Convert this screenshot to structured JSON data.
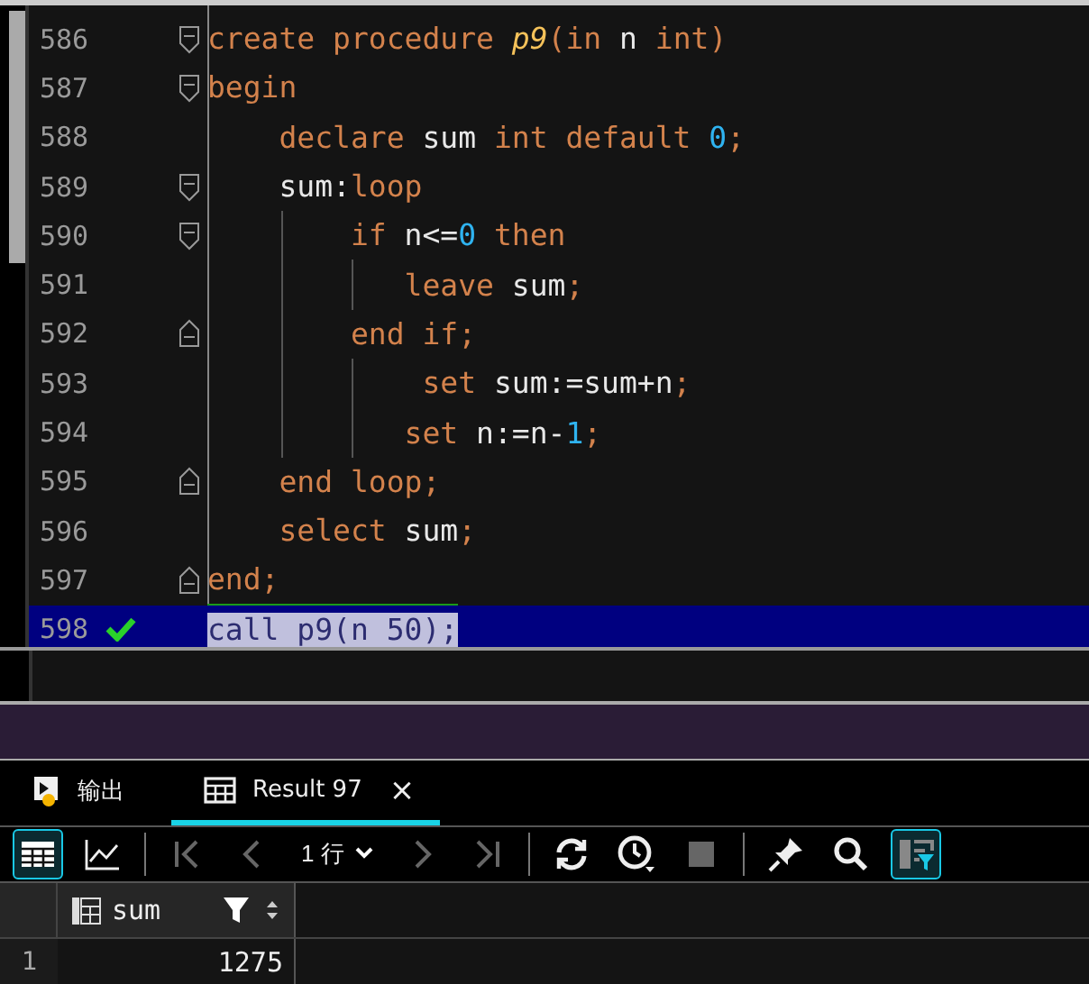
{
  "editor": {
    "lines": [
      {
        "number": "586",
        "kind": "fold_start",
        "current": false,
        "tokens": [
          {
            "kind": "kw",
            "text": "create procedure "
          },
          {
            "kind": "fn",
            "text": "p9"
          },
          {
            "kind": "kw",
            "text": "(in "
          },
          {
            "kind": "id",
            "text": "n"
          },
          {
            "kind": "kw",
            "text": " int)"
          }
        ]
      },
      {
        "number": "587",
        "kind": "fold_start",
        "current": false,
        "tokens": [
          {
            "kind": "kw",
            "text": "begin"
          }
        ]
      },
      {
        "number": "588",
        "kind": "plain",
        "current": false,
        "tokens": [
          {
            "kind": "kw",
            "text": "    declare "
          },
          {
            "kind": "id",
            "text": "sum"
          },
          {
            "kind": "kw",
            "text": " int default "
          },
          {
            "kind": "num",
            "text": "0"
          },
          {
            "kind": "kw",
            "text": ";"
          }
        ]
      },
      {
        "number": "589",
        "kind": "fold_start",
        "current": false,
        "tokens": [
          {
            "kind": "id",
            "text": "    sum:"
          },
          {
            "kind": "kw",
            "text": "loop"
          }
        ]
      },
      {
        "number": "590",
        "kind": "fold_start",
        "current": false,
        "tokens": [
          {
            "kind": "kw",
            "text": "        if "
          },
          {
            "kind": "id",
            "text": "n<="
          },
          {
            "kind": "num",
            "text": "0"
          },
          {
            "kind": "kw",
            "text": " then"
          }
        ]
      },
      {
        "number": "591",
        "kind": "plain",
        "current": false,
        "tokens": [
          {
            "kind": "kw",
            "text": "           leave "
          },
          {
            "kind": "id",
            "text": "sum"
          },
          {
            "kind": "kw",
            "text": ";"
          }
        ]
      },
      {
        "number": "592",
        "kind": "fold_end",
        "current": false,
        "tokens": [
          {
            "kind": "kw",
            "text": "        end if;"
          }
        ]
      },
      {
        "number": "593",
        "kind": "plain",
        "current": false,
        "tokens": [
          {
            "kind": "kw",
            "text": "            set "
          },
          {
            "kind": "id",
            "text": "sum:=sum+n"
          },
          {
            "kind": "kw",
            "text": ";"
          }
        ]
      },
      {
        "number": "594",
        "kind": "plain",
        "current": false,
        "tokens": [
          {
            "kind": "kw",
            "text": "           set "
          },
          {
            "kind": "id",
            "text": "n:=n-"
          },
          {
            "kind": "num",
            "text": "1"
          },
          {
            "kind": "kw",
            "text": ";"
          }
        ]
      },
      {
        "number": "595",
        "kind": "fold_end",
        "current": false,
        "tokens": [
          {
            "kind": "kw",
            "text": "    end loop;"
          }
        ]
      },
      {
        "number": "596",
        "kind": "plain",
        "current": false,
        "tokens": [
          {
            "kind": "kw",
            "text": "    select "
          },
          {
            "kind": "id",
            "text": "sum"
          },
          {
            "kind": "kw",
            "text": ";"
          }
        ]
      },
      {
        "number": "597",
        "kind": "fold_end",
        "current": false,
        "tokens": [
          {
            "kind": "kw",
            "text": "end;"
          }
        ]
      },
      {
        "number": "598",
        "kind": "plain",
        "current": true,
        "executed": true,
        "tokens": [
          {
            "kind": "sel",
            "text": "call p9(n 50);"
          }
        ]
      }
    ]
  },
  "tabs": [
    {
      "kind": "output",
      "label": "输出",
      "selected": false,
      "closable": false
    },
    {
      "kind": "result",
      "label": "Result 97",
      "selected": true,
      "closable": true,
      "close": "×"
    }
  ],
  "toolbar": [
    {
      "kind": "grid",
      "selected": true,
      "disabled": false
    },
    {
      "kind": "chart",
      "selected": false,
      "disabled": false
    },
    {
      "kind": "sep"
    },
    {
      "kind": "first",
      "selected": false,
      "disabled": true
    },
    {
      "kind": "prev",
      "selected": false,
      "disabled": true
    },
    {
      "kind": "rows",
      "label": "1 行",
      "selected": false,
      "disabled": false
    },
    {
      "kind": "next",
      "selected": false,
      "disabled": true
    },
    {
      "kind": "last",
      "selected": false,
      "disabled": true
    },
    {
      "kind": "sep"
    },
    {
      "kind": "refresh",
      "selected": false,
      "disabled": false
    },
    {
      "kind": "history",
      "selected": false,
      "disabled": false
    },
    {
      "kind": "stop",
      "selected": false,
      "disabled": true
    },
    {
      "kind": "sep"
    },
    {
      "kind": "pin",
      "selected": false,
      "disabled": false
    },
    {
      "kind": "search",
      "selected": false,
      "disabled": false
    },
    {
      "kind": "panel",
      "selected": true,
      "disabled": false
    }
  ],
  "grid": {
    "columns": [
      {
        "name": "sum",
        "filtered": true
      }
    ],
    "rows": [
      {
        "number": "1",
        "cells": [
          "1275"
        ]
      }
    ]
  }
}
